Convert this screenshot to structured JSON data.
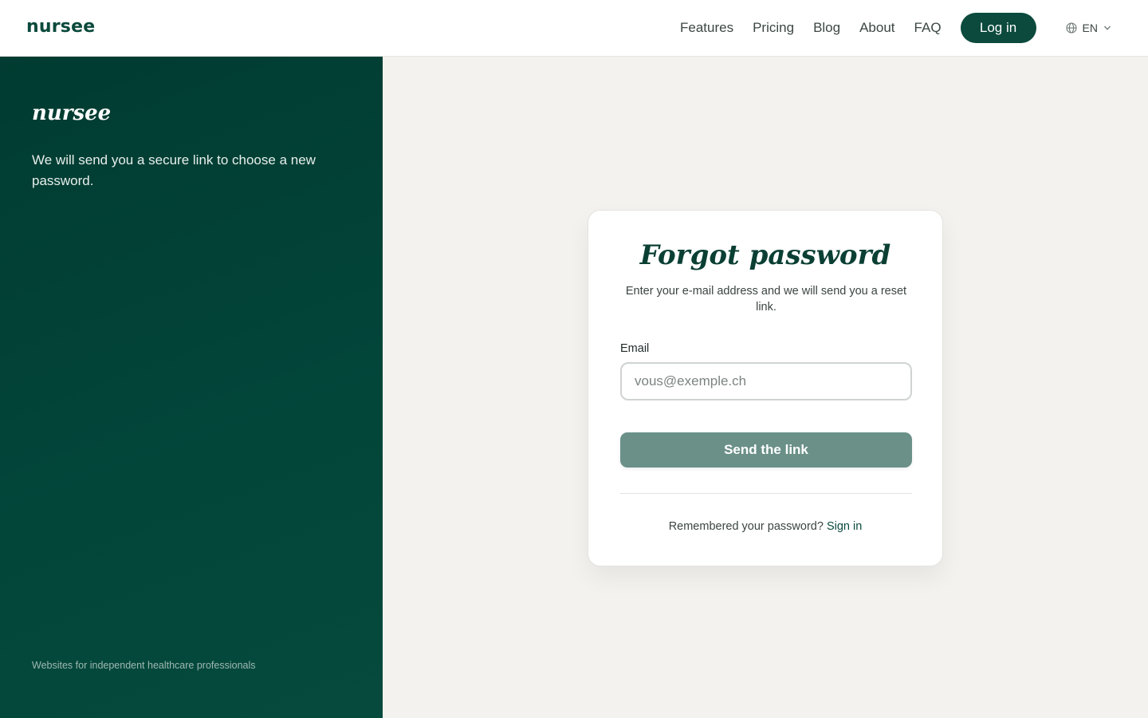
{
  "header": {
    "brand": "nursee",
    "nav": [
      "Features",
      "Pricing",
      "Blog",
      "About",
      "FAQ"
    ],
    "login_label": "Log in",
    "language": "EN"
  },
  "left_panel": {
    "logo": "nursee",
    "message": "We will send you a secure link to choose a new password.",
    "footer": "Websites for independent healthcare professionals"
  },
  "form": {
    "title": "Forgot password",
    "subtitle": "Enter your e-mail address and we will send you a reset link.",
    "email_label": "Email",
    "email_placeholder": "vous@exemple.ch",
    "email_value": "",
    "submit_label": "Send the link",
    "remember_text": "Remembered your password?",
    "signin_label": "Sign in"
  },
  "colors": {
    "brand_green": "#0b4a3c",
    "panel_green": "#013b31",
    "button_muted": "#6a9088",
    "background": "#f3f2ee"
  },
  "icons": {
    "language": "globe-icon",
    "dropdown": "chevron-down-icon"
  }
}
